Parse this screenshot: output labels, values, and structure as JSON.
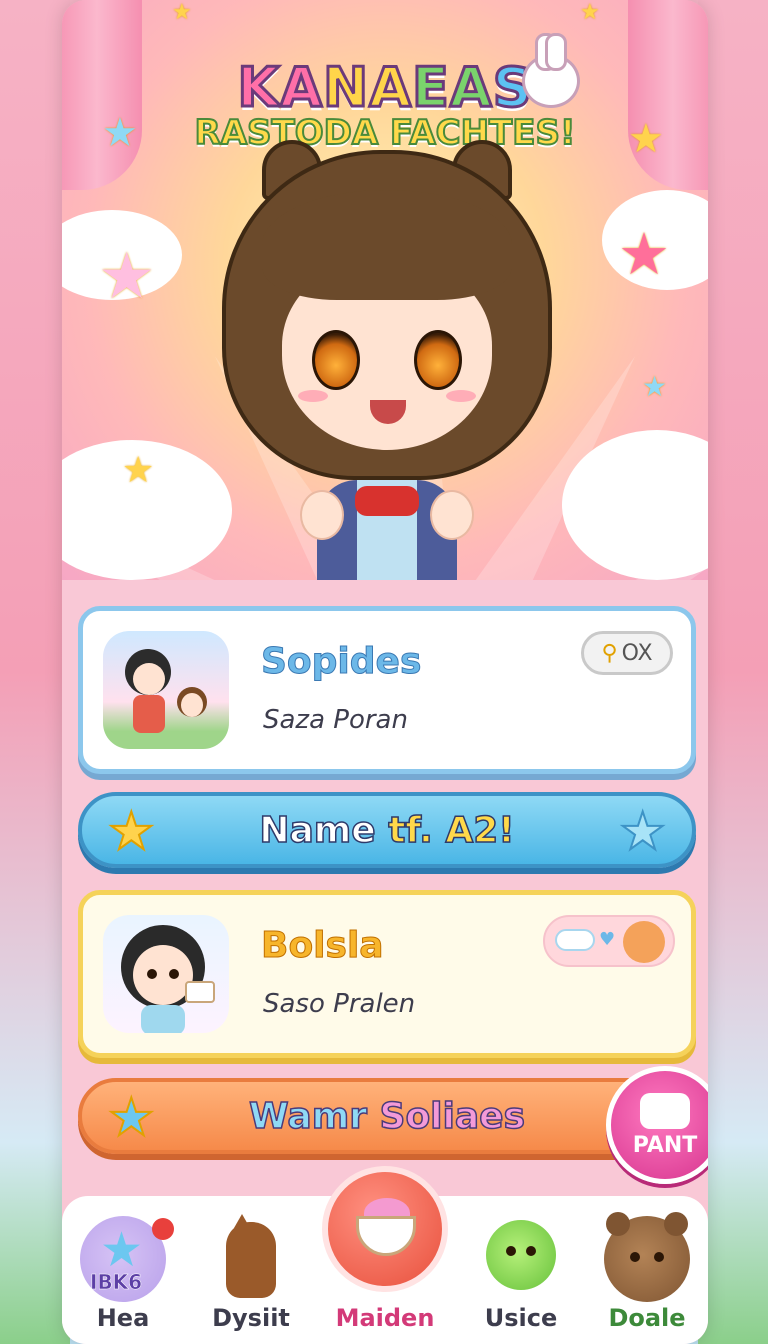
{
  "hero": {
    "title_line1": [
      "KA",
      "NA",
      "EA",
      "S"
    ],
    "title_line2": "RASTODA FACHTES!"
  },
  "cards": [
    {
      "title": "Sopides",
      "subtitle": "Saza Poran",
      "pill": "OX",
      "pill_icon": "key-icon"
    },
    {
      "title": "Bolsla",
      "subtitle": "Saso Pralen",
      "pill_icon": "cloud-heart-icon"
    }
  ],
  "banner1": {
    "text_a": "Name ",
    "text_b": "tf. A2!",
    "left_icon": "star-icon",
    "right_icon": "star-icon"
  },
  "banner2": {
    "text_a": "Wamr ",
    "text_b": "Soliaes",
    "left_icon": "star-icon"
  },
  "paint_button": {
    "label": "PANT"
  },
  "nav": {
    "items": [
      {
        "label": "Hea",
        "badge": "IBK6"
      },
      {
        "label": "Dysiit"
      },
      {
        "label": "Maiden"
      },
      {
        "label": "Usice"
      },
      {
        "label": "Doale"
      }
    ],
    "active": "Maiden"
  },
  "colors": {
    "accent_pink": "#d33a78",
    "banner_blue": "#4ab6e6",
    "banner_orange": "#f68a4a",
    "gold": "#f7b52b"
  }
}
